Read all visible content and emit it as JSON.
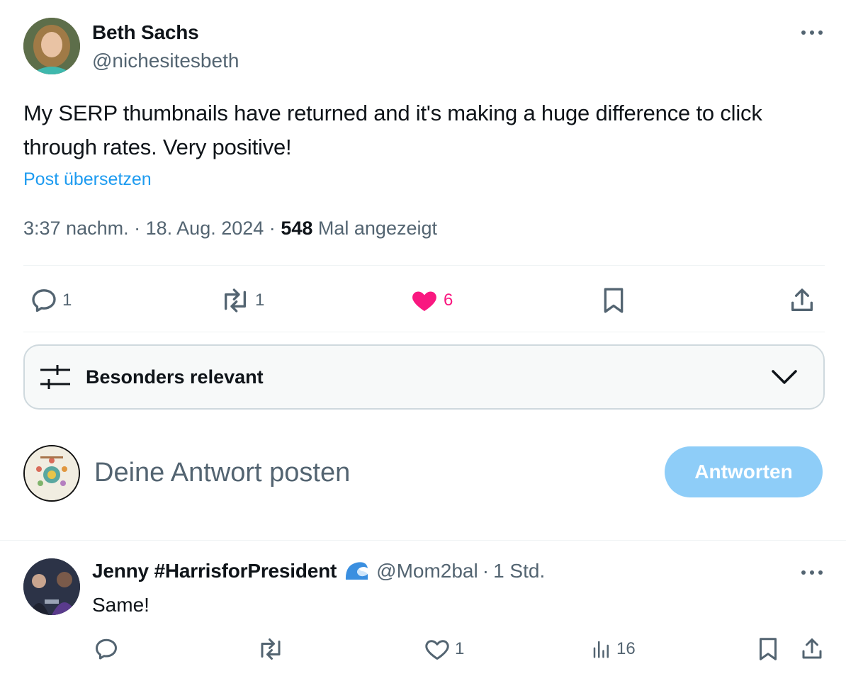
{
  "post": {
    "author_name": "Beth Sachs",
    "author_handle": "@nichesitesbeth",
    "text": "My SERP thumbnails have returned and it's making a huge difference to click through rates. Very positive!",
    "translate_label": "Post übersetzen",
    "time": "3:37 nachm.",
    "date": "18. Aug. 2024",
    "separator": "·",
    "views_count": "548",
    "views_label": "Mal angezeigt",
    "actions": {
      "reply_count": "1",
      "repost_count": "1",
      "like_count": "6"
    },
    "icons": [
      "more-icon",
      "reply-icon",
      "repost-icon",
      "heart-filled-icon",
      "bookmark-icon",
      "share-icon"
    ]
  },
  "sort": {
    "label": "Besonders relevant",
    "icons": [
      "sliders-icon",
      "chevron-down-icon"
    ]
  },
  "compose": {
    "placeholder": "Deine Antwort posten",
    "button_label": "Antworten"
  },
  "reply": {
    "author_name": "Jenny #HarrisforPresident",
    "badge_icon": "blue-wave-icon",
    "author_handle": "@Mom2bal",
    "separator": "·",
    "time": "1 Std.",
    "text": "Same!",
    "actions": {
      "reply_count": "",
      "repost_count": "",
      "like_count": "1",
      "views_count": "16"
    }
  },
  "colors": {
    "like_pink": "#f91880",
    "link_blue": "#1d9bf0",
    "button_disabled_blue": "#8ecdf8",
    "muted_text": "#536471"
  }
}
